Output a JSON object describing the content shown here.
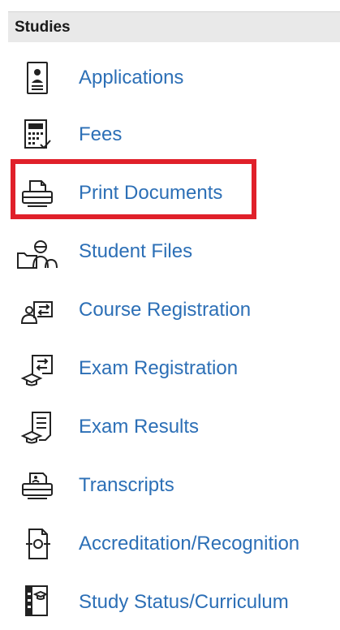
{
  "header": {
    "title": "Studies"
  },
  "items": [
    {
      "label": "Applications",
      "icon": "id-card-icon"
    },
    {
      "label": "Fees",
      "icon": "calculator-icon"
    },
    {
      "label": "Print Documents",
      "icon": "printer-icon"
    },
    {
      "label": "Student Files",
      "icon": "student-files-icon"
    },
    {
      "label": "Course Registration",
      "icon": "course-registration-icon"
    },
    {
      "label": "Exam Registration",
      "icon": "exam-registration-icon"
    },
    {
      "label": "Exam Results",
      "icon": "exam-results-icon"
    },
    {
      "label": "Transcripts",
      "icon": "transcripts-icon"
    },
    {
      "label": "Accreditation/Recognition",
      "icon": "accreditation-icon"
    },
    {
      "label": "Study Status/Curriculum",
      "icon": "study-status-icon"
    }
  ],
  "colors": {
    "link": "#2c6fb6",
    "highlight": "#e0202a",
    "header_bg": "#e9e9e9"
  }
}
